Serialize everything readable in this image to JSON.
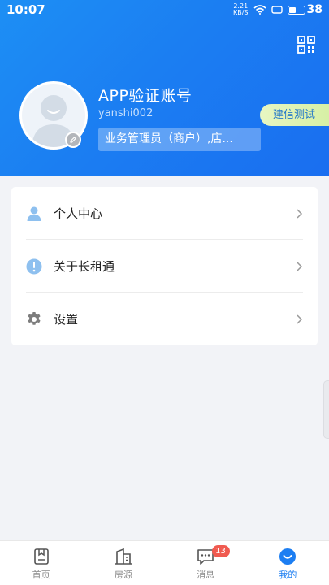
{
  "status_bar": {
    "time": "10:07",
    "net_speed_value": "2.21",
    "net_speed_unit": "KB/S",
    "battery": "38"
  },
  "profile": {
    "name": "APP验证账号",
    "user_id": "yanshi002",
    "role": "业务管理员（商户）,店...",
    "env_tag": "建信测试"
  },
  "menu": {
    "items": [
      {
        "label": "个人中心",
        "icon": "person-icon"
      },
      {
        "label": "关于长租通",
        "icon": "info-icon"
      },
      {
        "label": "设置",
        "icon": "gear-icon"
      }
    ]
  },
  "tabbar": {
    "tabs": [
      {
        "label": "首页",
        "icon": "home-icon"
      },
      {
        "label": "房源",
        "icon": "building-icon"
      },
      {
        "label": "消息",
        "icon": "message-icon",
        "badge": "13"
      },
      {
        "label": "我的",
        "icon": "profile-icon",
        "active": true
      }
    ]
  },
  "colors": {
    "accent": "#1c7ef2",
    "header_gradient_start": "#1d8ff4",
    "header_gradient_end": "#1a6ef0",
    "badge": "#f05a50",
    "env_tag_bg": "#dff3b4"
  }
}
